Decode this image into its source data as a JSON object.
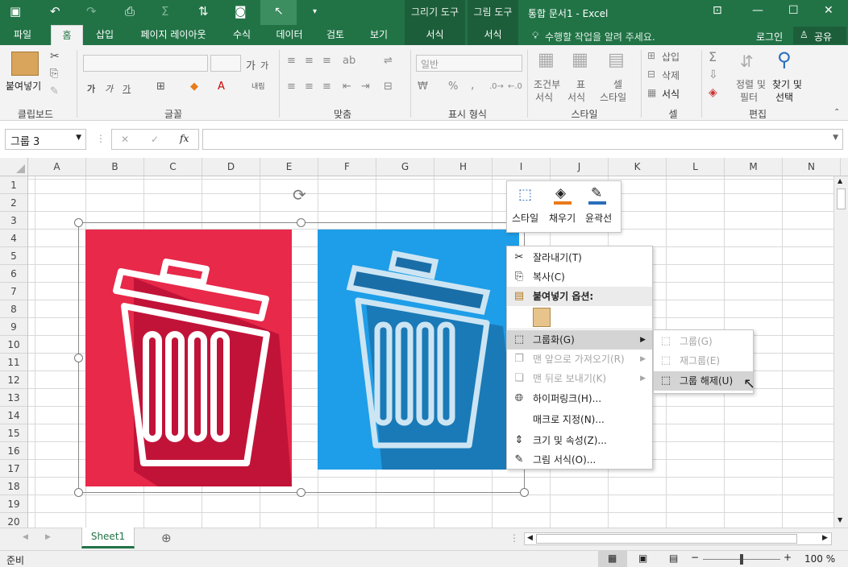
{
  "title": {
    "doc": "통합 문서1 - Excel",
    "ctx_drawing": "그리기 도구",
    "ctx_picture": "그림 도구"
  },
  "tabs": {
    "file": "파일",
    "home": "홈",
    "insert": "삽입",
    "layout": "페이지 레이아웃",
    "formulas": "수식",
    "data": "데이터",
    "review": "검토",
    "view": "보기",
    "format1": "서식",
    "format2": "서식",
    "tellme": "수행할 작업을 알려 주세요.",
    "login": "로그인",
    "share": "공유"
  },
  "ribbon": {
    "paste": "붙여넣기",
    "clipboard": "클립보드",
    "font": "글꼴",
    "align": "맞춤",
    "number": "표시 형식",
    "number_format": "일반",
    "styles": "스타일",
    "cells": "셀",
    "editing": "편집",
    "cond1": "조건부",
    "cond2": "서식",
    "table1": "표",
    "table2": "서식",
    "cell1": "셀",
    "cell2": "스타일",
    "insert": "삽입",
    "delete": "삭제",
    "format": "서식",
    "sort1": "정렬 및",
    "sort2": "필터",
    "find1": "찾기 및",
    "find2": "선택",
    "font_big": "가",
    "font_small": "가",
    "bold": "가",
    "italic": "가",
    "underline": "가",
    "wrap": "내림",
    "percent": "%",
    "comma": ","
  },
  "formula": {
    "namebox": "그룹 3",
    "fx": "fx",
    "cancel": "✕",
    "enter": "✓"
  },
  "columns": [
    "A",
    "B",
    "C",
    "D",
    "E",
    "F",
    "G",
    "H",
    "I",
    "J",
    "K",
    "L",
    "M",
    "N"
  ],
  "rows": [
    "1",
    "2",
    "3",
    "4",
    "5",
    "6",
    "7",
    "8",
    "9",
    "10",
    "11",
    "12",
    "13",
    "14",
    "15",
    "16",
    "17",
    "18",
    "19",
    "20"
  ],
  "mini_toolbar": {
    "style": "스타일",
    "fill": "채우기",
    "outline": "윤곽선"
  },
  "context_menu": {
    "cut": "잘라내기(T)",
    "copy": "복사(C)",
    "paste_options": "붙여넣기 옵션:",
    "group": "그룹화(G)",
    "bring_front": "맨 앞으로 가져오기(R)",
    "send_back": "맨 뒤로 보내기(K)",
    "hyperlink": "하이퍼링크(H)...",
    "macro": "매크로 지정(N)...",
    "size": "크기 및 속성(Z)...",
    "format_picture": "그림 서식(O)..."
  },
  "submenu": {
    "group": "그룹(G)",
    "regroup": "재그룹(E)",
    "ungroup": "그룹 해제(U)"
  },
  "sheet": {
    "name": "Sheet1"
  },
  "status": {
    "ready": "준비",
    "zoom": "100 %"
  },
  "colors": {
    "excel_green": "#217346",
    "red_bg": "#e8294a",
    "blue_bg": "#1e9ee8"
  }
}
